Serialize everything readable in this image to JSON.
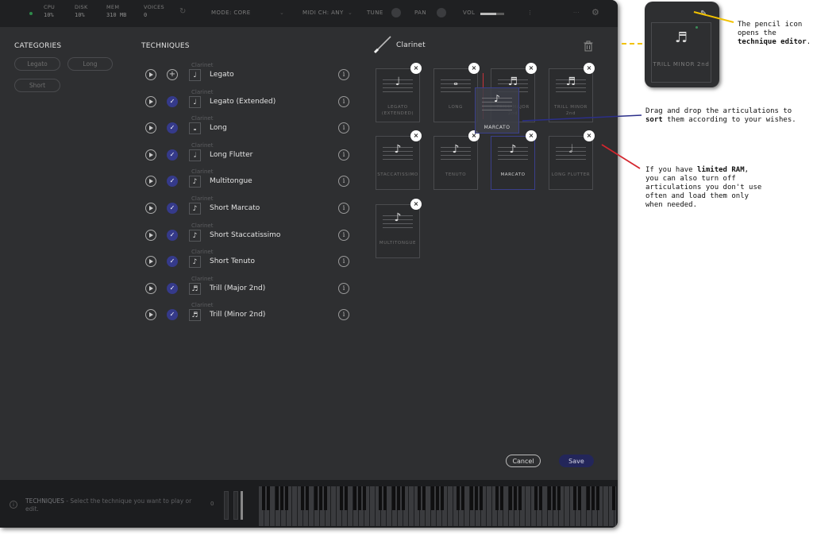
{
  "topbar": {
    "cpu_label": "CPU",
    "cpu_value": "10%",
    "disk_label": "DISK",
    "disk_value": "10%",
    "mem_label": "MEM",
    "mem_value": "310 MB",
    "voices_label": "VOICES",
    "voices_value": "0",
    "mode": "MODE: CORE",
    "midi": "MIDI CH:  ANY",
    "tune": "TUNE",
    "pan": "PAN",
    "vol": "VOL",
    "vol_level": 0.66
  },
  "categories": {
    "title": "CATEGORIES",
    "items": [
      "Legato",
      "Long",
      "Short"
    ]
  },
  "techniques": {
    "title": "TECHNIQUES",
    "rows": [
      {
        "instrument": "Clarinet",
        "name": "Legato",
        "enabled": false,
        "glyph": "♩"
      },
      {
        "instrument": "Clarinet",
        "name": "Legato (Extended)",
        "enabled": true,
        "glyph": "♩"
      },
      {
        "instrument": "Clarinet",
        "name": "Long",
        "enabled": true,
        "glyph": "𝅝"
      },
      {
        "instrument": "Clarinet",
        "name": "Long Flutter",
        "enabled": true,
        "glyph": "𝅗𝅥"
      },
      {
        "instrument": "Clarinet",
        "name": "Multitongue",
        "enabled": true,
        "glyph": "♪"
      },
      {
        "instrument": "Clarinet",
        "name": "Short Marcato",
        "enabled": true,
        "glyph": "♪"
      },
      {
        "instrument": "Clarinet",
        "name": "Short Staccatissimo",
        "enabled": true,
        "glyph": "♪"
      },
      {
        "instrument": "Clarinet",
        "name": "Short Tenuto",
        "enabled": true,
        "glyph": "♪"
      },
      {
        "instrument": "Clarinet",
        "name": "Trill (Major 2nd)",
        "enabled": true,
        "glyph": "♬"
      },
      {
        "instrument": "Clarinet",
        "name": "Trill (Minor 2nd)",
        "enabled": true,
        "glyph": "♬"
      }
    ]
  },
  "editor": {
    "title": "Clarinet",
    "cards": [
      {
        "label": "LEGATO (EXTENDED)",
        "glyph": "♩"
      },
      {
        "label": "LONG",
        "glyph": "𝅝"
      },
      {
        "label": "TRILL MAJOR 2nd",
        "glyph": "♬"
      },
      {
        "label": "TRILL MINOR 2nd",
        "glyph": "♬"
      },
      {
        "label": "STACCATISSIMO",
        "glyph": "♪"
      },
      {
        "label": "TENUTO",
        "glyph": "♪"
      },
      {
        "label": "MARCATO",
        "glyph": "♪"
      },
      {
        "label": "LONG FLUTTER",
        "glyph": "𝅗𝅥"
      },
      {
        "label": "MULTITONGUE",
        "glyph": "♪"
      }
    ],
    "drag_label": "MARCATO",
    "remove_glyph": "×"
  },
  "buttons": {
    "cancel": "Cancel",
    "save": "Save"
  },
  "footer": {
    "hint_title": "TECHNIQUES",
    "hint_text": " - Select the technique you want to play or edit.",
    "transpose": "0"
  },
  "annotations": {
    "pencil_prefix": "The pencil icon opens the ",
    "pencil_bold": "technique editor",
    "pencil_suffix": ".",
    "drag_prefix": "Drag and drop the articulations to ",
    "drag_bold": "sort",
    "drag_suffix": " them according to your wishes.",
    "ram_prefix": "If you have ",
    "ram_bold": "limited RAM",
    "ram_suffix": ", you can also turn off articulations you don't use often and load them only when needed."
  },
  "zoom": {
    "card_label": "TRILL MINOR 2nd",
    "glyph": "♬"
  },
  "colors": {
    "accent": "#353a8a",
    "panel": "#2e2f31",
    "pencil_line": "#f2c200",
    "drag_line": "#2b2f8a",
    "ram_line": "#d4262e"
  },
  "icons": [
    "play-icon",
    "check-icon",
    "plus-icon",
    "info-icon",
    "trash-icon",
    "pencil-icon",
    "close-icon",
    "gear-icon",
    "chevron-down-icon"
  ]
}
